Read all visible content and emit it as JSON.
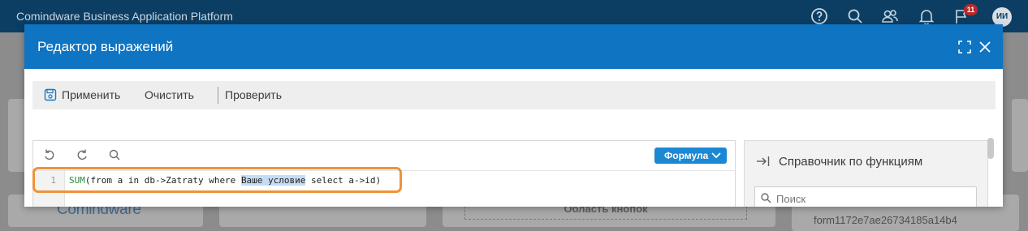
{
  "app": {
    "title": "Comindware Business Application Platform"
  },
  "header_icons": [
    "help-icon",
    "search-icon",
    "users-icon",
    "bell-icon",
    "flag-icon"
  ],
  "notifications": {
    "count": "11"
  },
  "user": {
    "initials": "ИИ"
  },
  "background": {
    "brand": "Comindware",
    "area_label": "Область кнопок",
    "form_id": "form1172e7ae26734185a14b4"
  },
  "modal": {
    "title": "Редактор выражений",
    "toolbar": {
      "apply_label": "Применить",
      "clear_label": "Очистить",
      "check_label": "Проверить"
    },
    "editor": {
      "mode_label": "Формула",
      "line_number": "1",
      "code": {
        "fn": "SUM",
        "before": "(from a in db->Zatraty where ",
        "highlight": "Ваше условие",
        "after": " select a->id)"
      }
    },
    "side_panel": {
      "title": "Справочник по функциям",
      "search_placeholder": "Поиск"
    }
  },
  "colors": {
    "app_bar": "#0c3e63",
    "modal_header": "#0f74c2",
    "formula_button": "#1b88d4",
    "focus_ring": "#f0923a",
    "badge": "#b52a2a"
  }
}
